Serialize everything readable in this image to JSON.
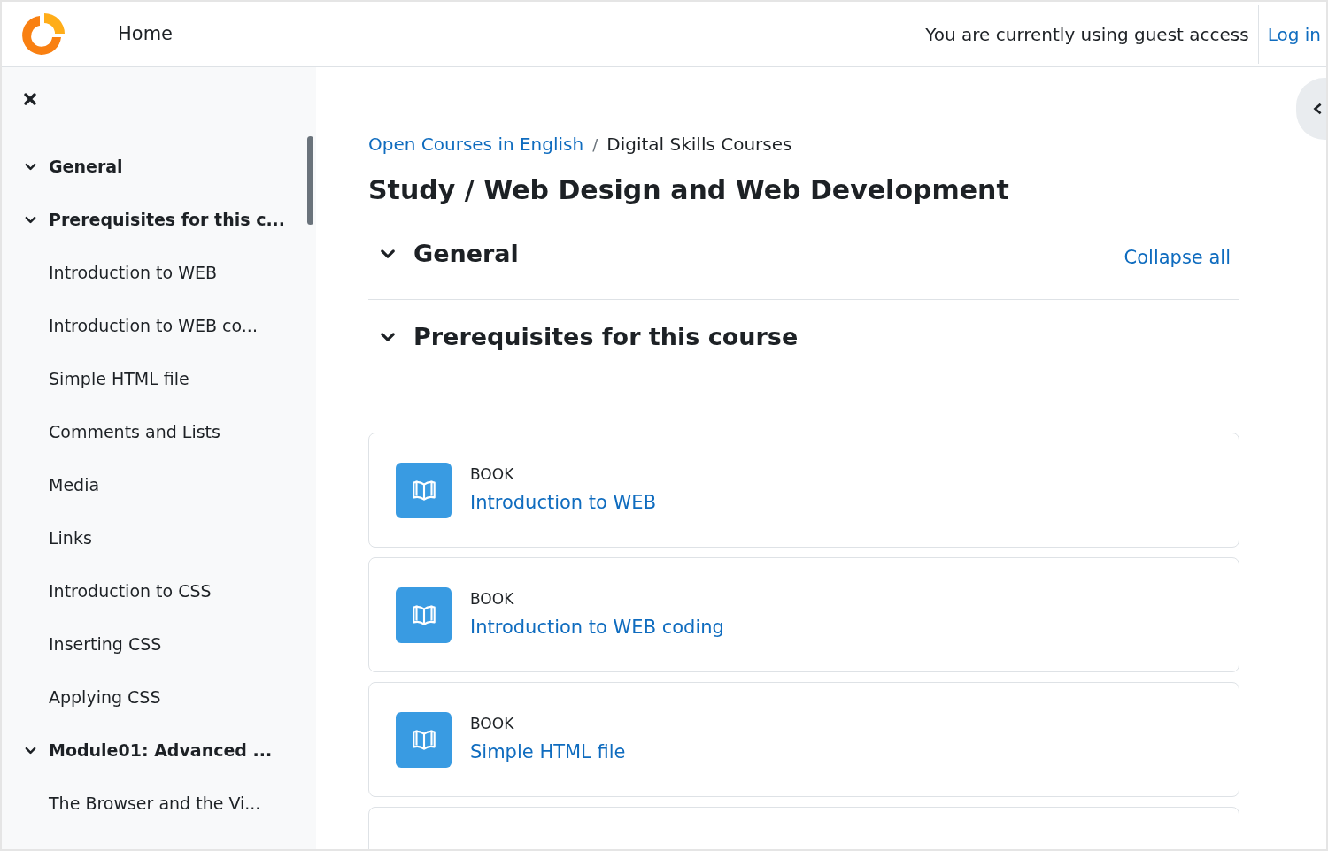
{
  "header": {
    "nav": "Home",
    "guest_notice": "You are currently using guest access",
    "login": "Log in"
  },
  "sidebar": {
    "sections": [
      {
        "title": "General",
        "expanded": true
      },
      {
        "title": "Prerequisites for this c...",
        "expanded": true,
        "children": [
          "Introduction to WEB",
          "Introduction to WEB co...",
          "Simple HTML file",
          "Comments and Lists",
          "Media",
          "Links",
          "Introduction to CSS",
          "Inserting CSS",
          "Applying CSS"
        ]
      },
      {
        "title": "Module01: Advanced ...",
        "expanded": true,
        "children": [
          "The Browser and the Vi..."
        ]
      }
    ]
  },
  "breadcrumb": [
    {
      "label": "Open Courses in English",
      "link": true
    },
    {
      "label": "Digital Skills Courses",
      "link": false
    }
  ],
  "breadcrumb_separator": "/",
  "page_title": "Study / Web Design and Web Development",
  "sections": [
    {
      "title": "General",
      "expanded": true,
      "action": "Collapse all"
    },
    {
      "title": "Prerequisites for this course",
      "expanded": true,
      "activities": [
        {
          "type": "BOOK",
          "name": "Introduction to WEB"
        },
        {
          "type": "BOOK",
          "name": "Introduction to WEB coding"
        },
        {
          "type": "BOOK",
          "name": "Simple HTML file"
        }
      ]
    }
  ]
}
